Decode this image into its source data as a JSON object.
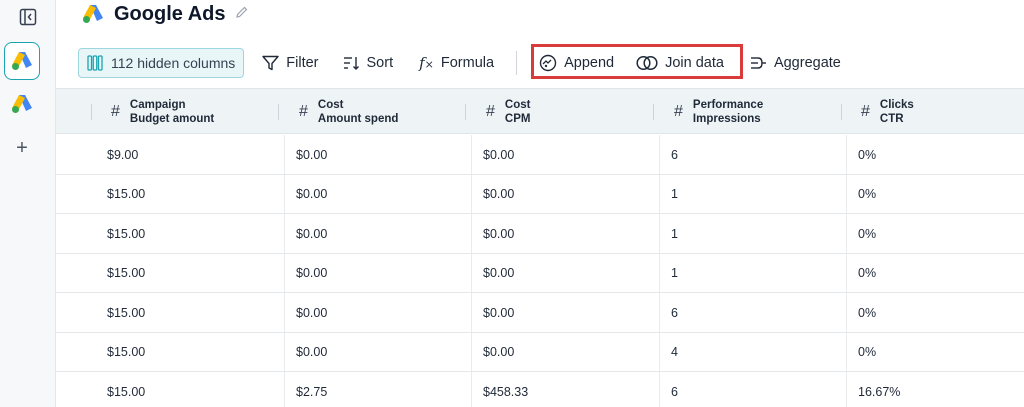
{
  "header": {
    "title": "Google Ads"
  },
  "toolbar": {
    "hidden_columns": "112 hidden columns",
    "filter": "Filter",
    "sort": "Sort",
    "formula": "Formula",
    "append": "Append",
    "join_data": "Join data",
    "aggregate": "Aggregate"
  },
  "sidebar": {
    "add": "+"
  },
  "colors": {
    "accent": "#1aa3b0",
    "highlight": "#d93a3a",
    "google_blue": "#4285f4",
    "google_yellow": "#fbbc04",
    "google_green": "#34a853"
  },
  "table": {
    "columns": [
      {
        "line1": "Campaign",
        "line2": "Budget amount"
      },
      {
        "line1": "Cost",
        "line2": "Amount spend"
      },
      {
        "line1": "Cost",
        "line2": "CPM"
      },
      {
        "line1": "Performance",
        "line2": "Impressions"
      },
      {
        "line1": "Clicks",
        "line2": "CTR"
      }
    ],
    "rows": [
      [
        "$9.00",
        "$0.00",
        "$0.00",
        "6",
        "0%"
      ],
      [
        "$15.00",
        "$0.00",
        "$0.00",
        "1",
        "0%"
      ],
      [
        "$15.00",
        "$0.00",
        "$0.00",
        "1",
        "0%"
      ],
      [
        "$15.00",
        "$0.00",
        "$0.00",
        "1",
        "0%"
      ],
      [
        "$15.00",
        "$0.00",
        "$0.00",
        "6",
        "0%"
      ],
      [
        "$15.00",
        "$0.00",
        "$0.00",
        "4",
        "0%"
      ],
      [
        "$15.00",
        "$2.75",
        "$458.33",
        "6",
        "16.67%"
      ]
    ]
  }
}
